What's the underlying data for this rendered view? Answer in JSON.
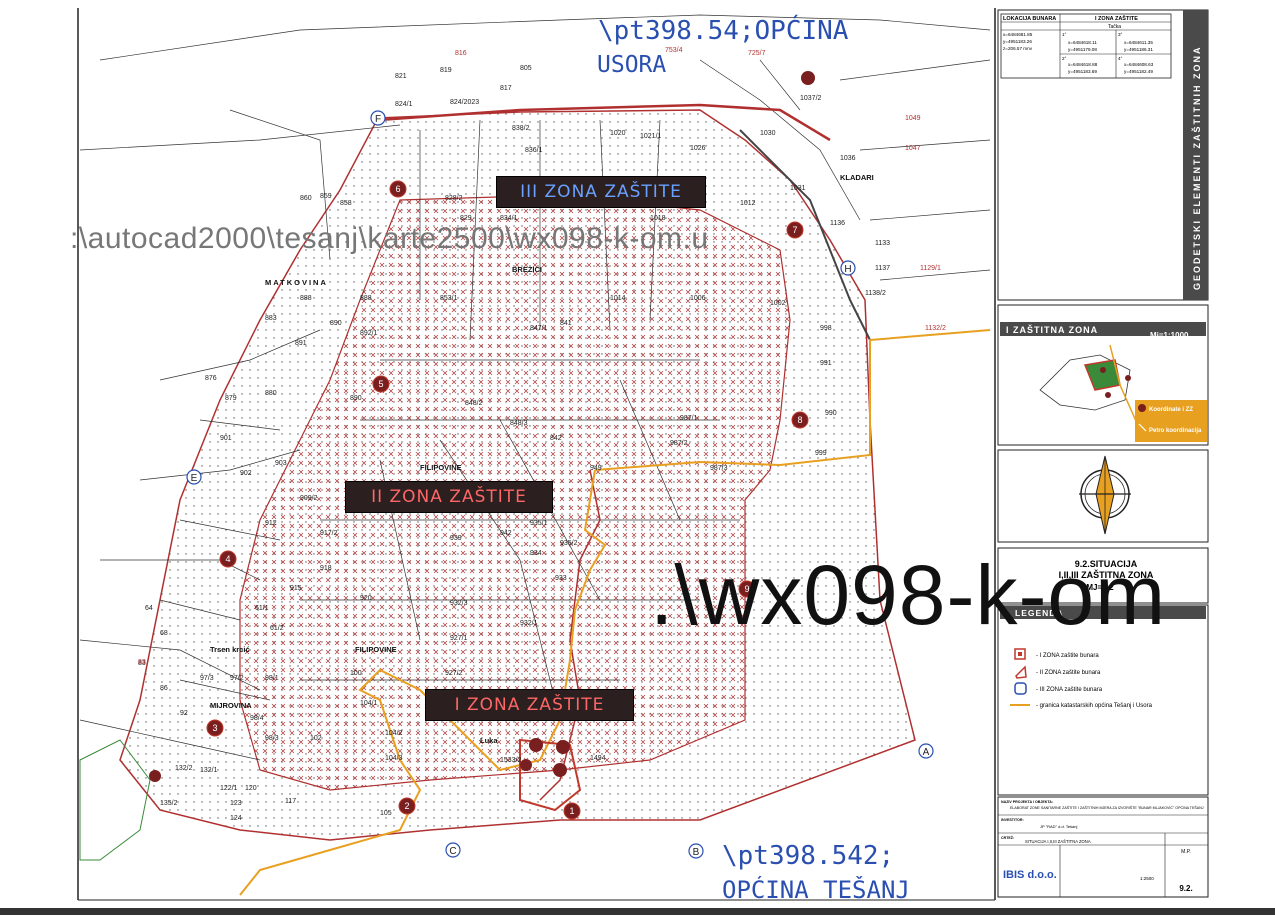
{
  "overlays": {
    "path_top": "\\pt398.54;OPĆINA",
    "path_top_2": "USORA",
    "path_left": ":\\autocad2000\\tesanj\\karte2500\\wx098-k-om.u",
    "path_right": ".\\wx098-k-om",
    "path_bottom": "\\pt398.542;",
    "path_bottom_2": "OPĆINA TEŠANJ"
  },
  "zones": {
    "zone3": "III ZONA ZAŠTITE",
    "zone2": "II ZONA ZAŠTITE",
    "zone1": "I ZONA ZAŠTITE"
  },
  "place_names": [
    "MATKOVINA",
    "BREZICI",
    "FILIPOVINE",
    "FILIPOVINE",
    "MIJROVINA",
    "KLADARI",
    "Trsen krcić",
    "Luka"
  ],
  "coord_table": {
    "headers": [
      "LOKACIJA BUNARA",
      "I ZONA ZAŠTITE"
    ],
    "sub": "Tačka",
    "rows": [
      [
        "x=6484681.85",
        "1°",
        "x=6484618.11",
        "3°",
        "x=6484611.35"
      ],
      [
        "y=4951183.26",
        "",
        "y=4951179.08",
        "",
        "y=4951186.31"
      ],
      [
        "z=206.57 mnv",
        "2°",
        "x=6484618.88",
        "4°",
        "x=6484608.63"
      ],
      [
        "",
        "",
        "y=4951183.69",
        "",
        "y=4951182.49"
      ]
    ]
  },
  "side_title": "GEODETSKI ELEMENTI ZAŠTITNIH ZONA",
  "inset": {
    "title": "I ZAŠTITNA ZONA",
    "scale": "Mj=1:1000",
    "legend_1": "Koordinate i ZZ",
    "legend_2": "Petro koordinacija"
  },
  "situation": {
    "line1": "9.2.SITUACIJA",
    "line2": "I,II,III ZAŠTITNA ZONA",
    "line3": "MJ=1:2"
  },
  "legend": {
    "title": "LEGENDA",
    "items": [
      "- I ZONA zaštite bunara",
      "- II ZONA zaštite bunara",
      "- III ZONA zaštite bunara",
      "- granica katastarskih općina Tešanj i Usora"
    ]
  },
  "title_block": {
    "project_label": "NAZIV PROJEKTA I OBJEKTA:",
    "project": "ELABORAT ZONE SANITARNE ZAŠTITE I ZAŠTITNIH MJERA ZA IZVORIŠTE \"BUNAR MLJAKOVIĆ\" OPĆINA TEŠANJ",
    "investor_label": "INVESTITOR:",
    "investor": "JP \"RAD\" d.d. Tešanj",
    "drawing_label": "CRTEŽ:",
    "drawing": "SITUACIJA I,II,III ZAŠTITNA ZONA",
    "company": "IBIS d.o.o.",
    "sheet_no": "9.2.",
    "mp": "M.P.",
    "scale": "1:2500"
  },
  "point_labels": [
    "A",
    "B",
    "C",
    "E",
    "F",
    "H"
  ],
  "well_markers": [
    "1",
    "2",
    "3",
    "4",
    "5",
    "6",
    "7",
    "8",
    "9"
  ],
  "colors": {
    "zone_red": "#c0392b",
    "boundary_orange": "#e8a020",
    "overlay_blue": "#2a4fb0",
    "label_bg": "#2b1f1f",
    "sidebar_bg": "#4a4a4a"
  }
}
